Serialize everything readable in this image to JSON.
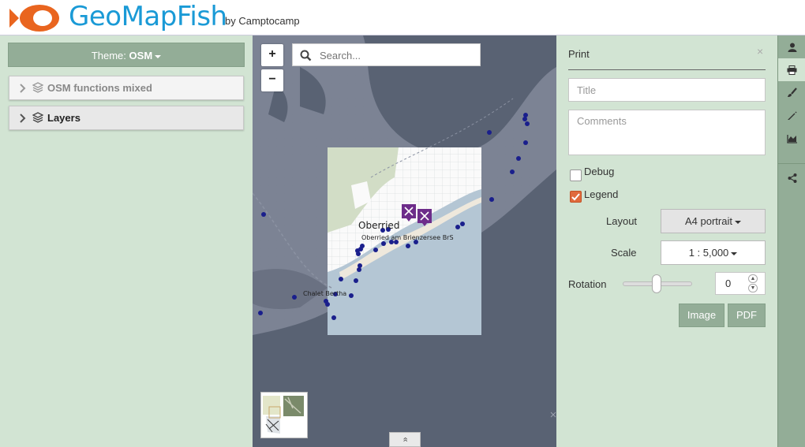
{
  "header": {
    "brand": "GeoMapFish",
    "byline": "by Camptocamp",
    "colors": {
      "brand": "#1a9ad6",
      "logo": "#e9651f"
    }
  },
  "left_panel": {
    "theme_prefix": "Theme:",
    "theme_name": "OSM",
    "groups": [
      {
        "label": "OSM functions mixed",
        "icon": "layers-icon"
      },
      {
        "label": "Layers",
        "icon": "layers-icon"
      }
    ]
  },
  "map": {
    "zoom_in": "+",
    "zoom_out": "−",
    "search_placeholder": "Search...",
    "labels": [
      {
        "text": "Oberried"
      },
      {
        "text": "Oberried am Brienzersee BrS"
      },
      {
        "text": "Chalet Bertha"
      }
    ],
    "collapse_toggle": "«"
  },
  "print_panel": {
    "title": "Print",
    "close": "×",
    "title_placeholder": "Title",
    "comments_placeholder": "Comments",
    "debug_label": "Debug",
    "debug_checked": false,
    "legend_label": "Legend",
    "legend_checked": true,
    "layout_label": "Layout",
    "layout_value": "A4 portrait",
    "scale_label": "Scale",
    "scale_value": "1 : 5,000",
    "rotation_label": "Rotation",
    "rotation_value": "0",
    "image_button": "Image",
    "pdf_button": "PDF"
  },
  "toolbar": {
    "items": [
      {
        "icon": "user-icon",
        "active": false
      },
      {
        "icon": "print-icon",
        "active": true
      },
      {
        "icon": "brush-icon",
        "active": false
      },
      {
        "icon": "pencil-icon",
        "active": false
      },
      {
        "icon": "area-chart-icon",
        "active": false
      },
      {
        "icon": "share-icon",
        "active": false
      }
    ]
  },
  "colors": {
    "panel_bg": "#d2e4d3",
    "accent_green": "#93ad97",
    "water": "#596273",
    "checkbox_checked": "#e06a3c",
    "poi_marker": "#1a1f8c",
    "restaurant_marker": "#6d2c8a"
  }
}
